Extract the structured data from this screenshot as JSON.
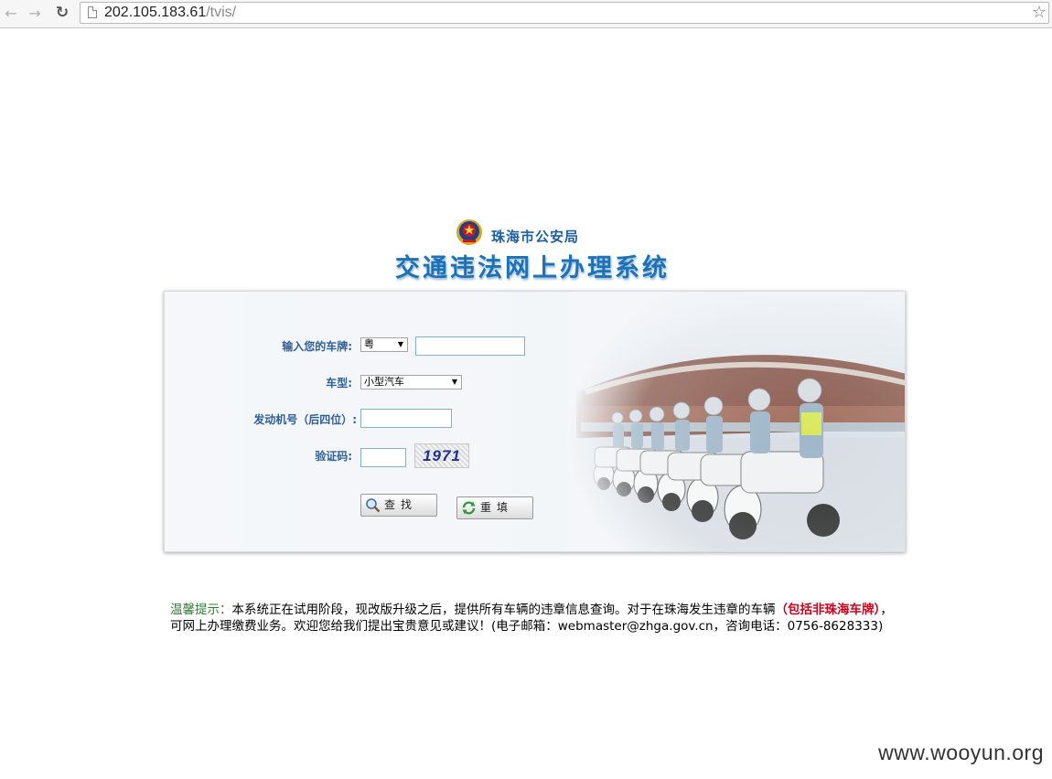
{
  "browser": {
    "url_host": "202.105.183.61",
    "url_path": "/tvis/"
  },
  "header": {
    "bureau": "珠海市公安局",
    "title": "交通违法网上办理系统"
  },
  "form": {
    "plate_label": "输入您的车牌:",
    "province_value": "粤",
    "plate_value": "",
    "type_label": "车型:",
    "type_value": "小型汽车",
    "engine_label": "发动机号（后四位）:",
    "engine_value": "",
    "code_label": "验证码:",
    "code_value": "",
    "captcha_text": "1971",
    "search_label": "查找",
    "reset_label": "重填"
  },
  "notice": {
    "tip_label": "温馨提示：",
    "text_1": "本系统正在试用阶段，现改版升级之后，提供所有车辆的违章信息查询。对于在珠海发生违章的车辆",
    "emphasis": "（包括非珠海车牌）",
    "text_2": "，可网上办理缴费业务。欢迎您给我们提出宝贵意见或建议！(电子邮箱：webmaster@zhga.gov.cn，咨询电话：0756-8628333)"
  },
  "watermark": "www.wooyun.org",
  "colors": {
    "label": "#2e5f9a",
    "title": "#1c72b8",
    "tip": "#2e7d2e",
    "emphasis": "#d0021b"
  },
  "icons": {
    "back": "back-arrow-icon",
    "forward": "forward-arrow-icon",
    "reload": "reload-icon",
    "page": "page-icon",
    "bookmark": "star-icon",
    "search_button": "magnifier-icon",
    "reset_button": "refresh-icon"
  }
}
